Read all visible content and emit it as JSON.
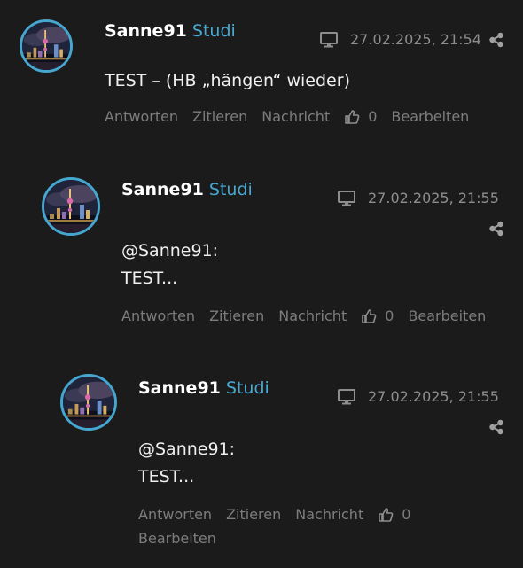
{
  "posts": [
    {
      "author": "Sanne91",
      "role": "Studi",
      "timestamp": "27.02.2025, 21:54",
      "body": [
        "TEST – (HB „hängen“ wieder)"
      ],
      "actions": {
        "reply": "Antworten",
        "quote": "Zitieren",
        "message": "Nachricht",
        "likes": "0",
        "edit": "Bearbeiten"
      },
      "icons": {
        "device": "monitor-icon",
        "share": "share-icon",
        "like": "thumbs-up-icon"
      }
    },
    {
      "author": "Sanne91",
      "role": "Studi",
      "timestamp": "27.02.2025, 21:55",
      "body": [
        "@Sanne91:",
        "TEST..."
      ],
      "actions": {
        "reply": "Antworten",
        "quote": "Zitieren",
        "message": "Nachricht",
        "likes": "0",
        "edit": "Bearbeiten"
      },
      "icons": {
        "device": "monitor-icon",
        "share": "share-icon",
        "like": "thumbs-up-icon"
      }
    },
    {
      "author": "Sanne91",
      "role": "Studi",
      "timestamp": "27.02.2025, 21:55",
      "body": [
        "@Sanne91:",
        "TEST..."
      ],
      "actions": {
        "reply": "Antworten",
        "quote": "Zitieren",
        "message": "Nachricht",
        "likes": "0",
        "edit": "Bearbeiten"
      },
      "icons": {
        "device": "monitor-icon",
        "share": "share-icon",
        "like": "thumbs-up-icon"
      }
    }
  ],
  "colors": {
    "background": "#1b1b1b",
    "accent": "#48a9d3",
    "avatar_border": "#45a6cf",
    "muted": "#7d7d7d"
  }
}
